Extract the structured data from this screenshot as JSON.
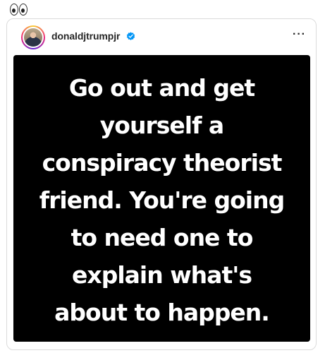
{
  "post": {
    "username": "donaldjtrumpjr",
    "verified": true,
    "more_icon": "more-horizontal-icon",
    "image_text_lines": [
      "Go out and get",
      "yourself a",
      "conspiracy theorist",
      "friend. You're going",
      "to need one to",
      "explain what's",
      "about to happen."
    ]
  },
  "caption": {
    "emoji": "eyes-emoji"
  },
  "colors": {
    "verified_blue": "#0095f6",
    "image_background": "#000000",
    "image_text": "#ffffff",
    "card_border": "#dbdbdb"
  }
}
